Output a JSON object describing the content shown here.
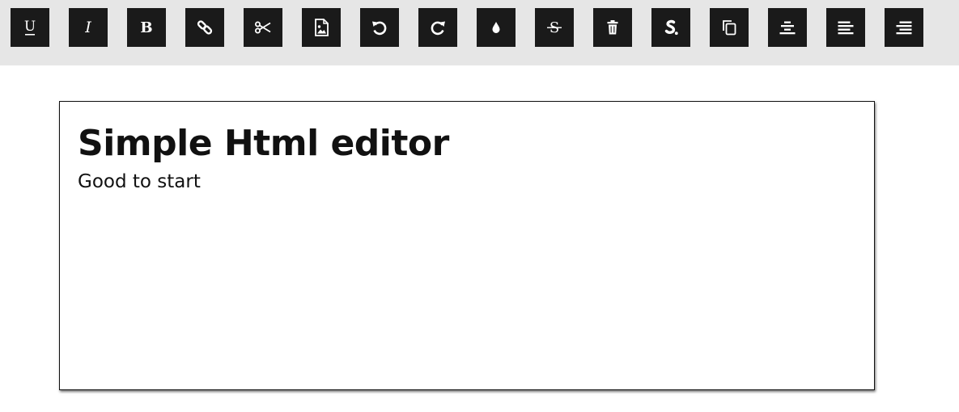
{
  "toolbar": {
    "buttons": [
      {
        "label": "U",
        "icon": "underline-icon"
      },
      {
        "label": "I",
        "icon": "italic-icon"
      },
      {
        "label": "B",
        "icon": "bold-icon"
      },
      {
        "icon": "link-icon"
      },
      {
        "icon": "scissors-icon"
      },
      {
        "icon": "image-file-icon"
      },
      {
        "icon": "undo-icon"
      },
      {
        "icon": "redo-icon"
      },
      {
        "icon": "ink-drop-icon"
      },
      {
        "label": "S",
        "icon": "strikethrough-icon"
      },
      {
        "icon": "trash-icon"
      },
      {
        "icon": "clear-format-icon"
      },
      {
        "icon": "copy-icon"
      },
      {
        "icon": "align-center-icon"
      },
      {
        "icon": "align-left-icon"
      },
      {
        "icon": "align-right-icon"
      }
    ]
  },
  "editor": {
    "title": "Simple Html editor",
    "body": "Good to start"
  },
  "colors": {
    "toolbar_background": "#e6e6e6",
    "button_background": "#1a1a1a",
    "icon_color": "#ffffff",
    "text_color": "#111111"
  }
}
